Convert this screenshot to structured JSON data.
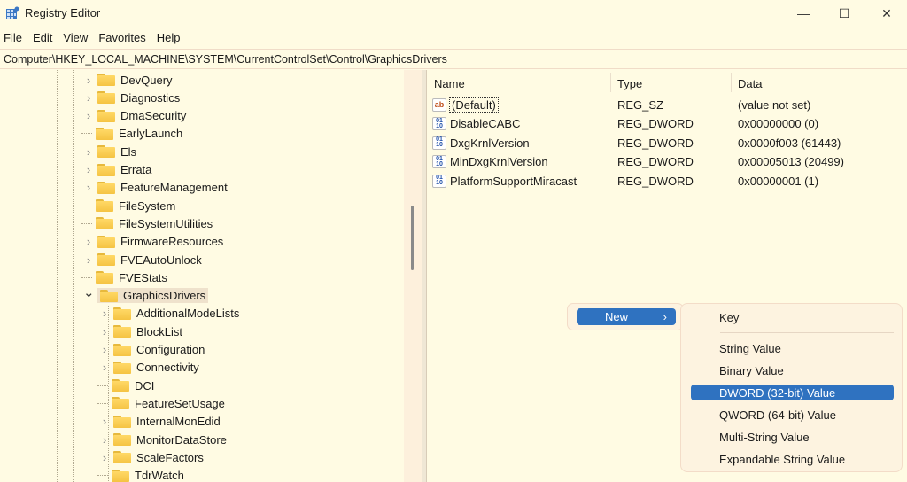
{
  "window": {
    "title": "Registry Editor",
    "minimize": "—",
    "maximize": "☐",
    "close": "✕"
  },
  "menu": [
    "File",
    "Edit",
    "View",
    "Favorites",
    "Help"
  ],
  "address": "Computer\\HKEY_LOCAL_MACHINE\\SYSTEM\\CurrentControlSet\\Control\\GraphicsDrivers",
  "tree": {
    "level1": [
      {
        "label": "DevQuery",
        "expandable": true
      },
      {
        "label": "Diagnostics",
        "expandable": true
      },
      {
        "label": "DmaSecurity",
        "expandable": true
      },
      {
        "label": "EarlyLaunch",
        "expandable": false
      },
      {
        "label": "Els",
        "expandable": true
      },
      {
        "label": "Errata",
        "expandable": true
      },
      {
        "label": "FeatureManagement",
        "expandable": true
      },
      {
        "label": "FileSystem",
        "expandable": false
      },
      {
        "label": "FileSystemUtilities",
        "expandable": false
      },
      {
        "label": "FirmwareResources",
        "expandable": true
      },
      {
        "label": "FVEAutoUnlock",
        "expandable": true
      },
      {
        "label": "FVEStats",
        "expandable": false
      },
      {
        "label": "GraphicsDrivers",
        "expandable": true,
        "expanded": true,
        "selected": true
      }
    ],
    "children": [
      {
        "label": "AdditionalModeLists",
        "expandable": true
      },
      {
        "label": "BlockList",
        "expandable": true
      },
      {
        "label": "Configuration",
        "expandable": true
      },
      {
        "label": "Connectivity",
        "expandable": true
      },
      {
        "label": "DCI",
        "expandable": false
      },
      {
        "label": "FeatureSetUsage",
        "expandable": false
      },
      {
        "label": "InternalMonEdid",
        "expandable": true
      },
      {
        "label": "MonitorDataStore",
        "expandable": true
      },
      {
        "label": "ScaleFactors",
        "expandable": true
      },
      {
        "label": "TdrWatch",
        "expandable": false
      }
    ]
  },
  "values": {
    "headers": {
      "name": "Name",
      "type": "Type",
      "data": "Data"
    },
    "rows": [
      {
        "name": "(Default)",
        "type": "REG_SZ",
        "data": "(value not set)",
        "icon": "string-value-icon"
      },
      {
        "name": "DisableCABC",
        "type": "REG_DWORD",
        "data": "0x00000000 (0)",
        "icon": "binary-value-icon"
      },
      {
        "name": "DxgKrnlVersion",
        "type": "REG_DWORD",
        "data": "0x0000f003 (61443)",
        "icon": "binary-value-icon"
      },
      {
        "name": "MinDxgKrnlVersion",
        "type": "REG_DWORD",
        "data": "0x00005013 (20499)",
        "icon": "binary-value-icon"
      },
      {
        "name": "PlatformSupportMiracast",
        "type": "REG_DWORD",
        "data": "0x00000001 (1)",
        "icon": "binary-value-icon"
      }
    ]
  },
  "context_menu": {
    "new_label": "New",
    "arrow": "›",
    "submenu": [
      "Key",
      "String Value",
      "Binary Value",
      "DWORD (32-bit) Value",
      "QWORD (64-bit) Value",
      "Multi-String Value",
      "Expandable String Value"
    ],
    "highlighted": "DWORD (32-bit) Value"
  },
  "colors": {
    "background": "#fffbe3",
    "highlight": "#2f72c0"
  }
}
